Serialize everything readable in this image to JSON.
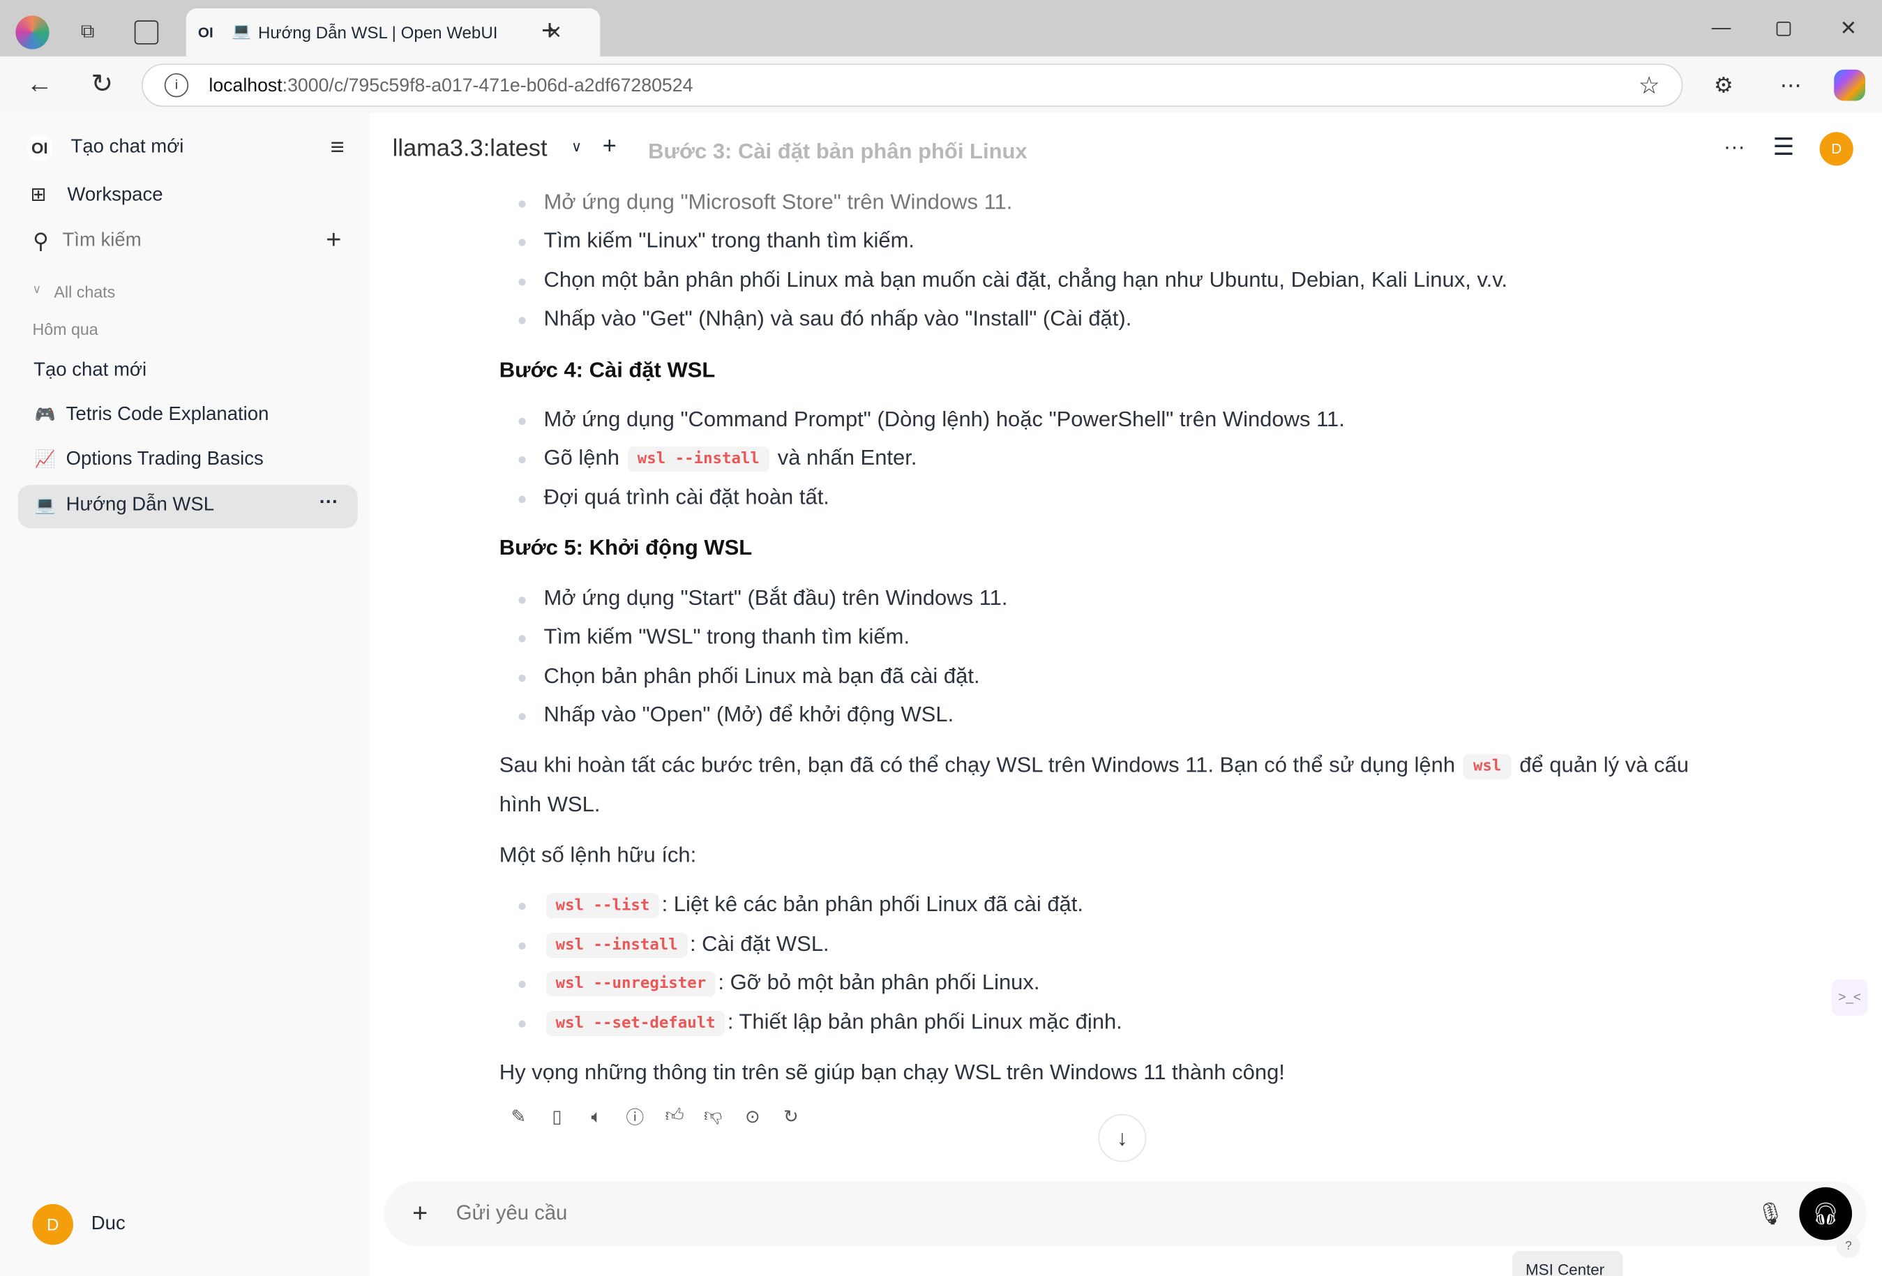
{
  "browser": {
    "tab_title": "Hướng Dẫn WSL | Open WebUI",
    "url_host": "localhost",
    "url_path": ":3000/c/795c59f8-a017-471e-b06d-a2df67280524"
  },
  "sidebar": {
    "logo": "OI",
    "new_chat": "Tạo chat mới",
    "workspace": "Workspace",
    "search_placeholder": "Tìm kiếm",
    "all_chats": "All chats",
    "group": "Hôm qua",
    "chats": [
      {
        "icon": "",
        "label": "Tạo chat mới"
      },
      {
        "icon": "🎮",
        "label": "Tetris Code Explanation"
      },
      {
        "icon": "📈",
        "label": "Options Trading Basics"
      },
      {
        "icon": "💻",
        "label": "Hướng Dẫn WSL",
        "active": true
      }
    ],
    "user": {
      "initial": "D",
      "name": "Duc"
    }
  },
  "header": {
    "model": "llama3.3:latest",
    "user_initial": "D"
  },
  "message": {
    "faded_heading": "Bước 3: Cài đặt bản phân phối Linux",
    "step3": [
      "Mở ứng dụng \"Microsoft Store\" trên Windows 11.",
      "Tìm kiếm \"Linux\" trong thanh tìm kiếm.",
      "Chọn một bản phân phối Linux mà bạn muốn cài đặt, chẳng hạn như Ubuntu, Debian, Kali Linux, v.v.",
      "Nhấp vào \"Get\" (Nhận) và sau đó nhấp vào \"Install\" (Cài đặt)."
    ],
    "step4_title": "Bước 4: Cài đặt WSL",
    "step4": {
      "a": "Mở ứng dụng \"Command Prompt\" (Dòng lệnh) hoặc \"PowerShell\" trên Windows 11.",
      "b_pre": "Gõ lệnh",
      "b_code": "wsl --install",
      "b_post": "và nhấn Enter.",
      "c": "Đợi quá trình cài đặt hoàn tất."
    },
    "step5_title": "Bước 5: Khởi động WSL",
    "step5": [
      "Mở ứng dụng \"Start\" (Bắt đầu) trên Windows 11.",
      "Tìm kiếm \"WSL\" trong thanh tìm kiếm.",
      "Chọn bản phân phối Linux mà bạn đã cài đặt.",
      "Nhấp vào \"Open\" (Mở) để khởi động WSL."
    ],
    "summary_pre": "Sau khi hoàn tất các bước trên, bạn đã có thể chạy WSL trên Windows 11. Bạn có thể sử dụng lệnh",
    "summary_code": "wsl",
    "summary_post": "để quản lý và cấu",
    "summary_line2": "hình WSL.",
    "useful": "Một số lệnh hữu ích:",
    "commands": [
      {
        "code": "wsl --list",
        "desc": ": Liệt kê các bản phân phối Linux đã cài đặt."
      },
      {
        "code": "wsl --install",
        "desc": ": Cài đặt WSL."
      },
      {
        "code": "wsl --unregister",
        "desc": ": Gỡ bỏ một bản phân phối Linux."
      },
      {
        "code": "wsl --set-default",
        "desc": ": Thiết lập bản phân phối Linux mặc định."
      }
    ],
    "closing": "Hy vọng những thông tin trên sẽ giúp bạn chạy WSL trên Windows 11 thành công!"
  },
  "input": {
    "placeholder": "Gửi yêu cầu"
  },
  "taskbar_tooltip": "MSI Center"
}
